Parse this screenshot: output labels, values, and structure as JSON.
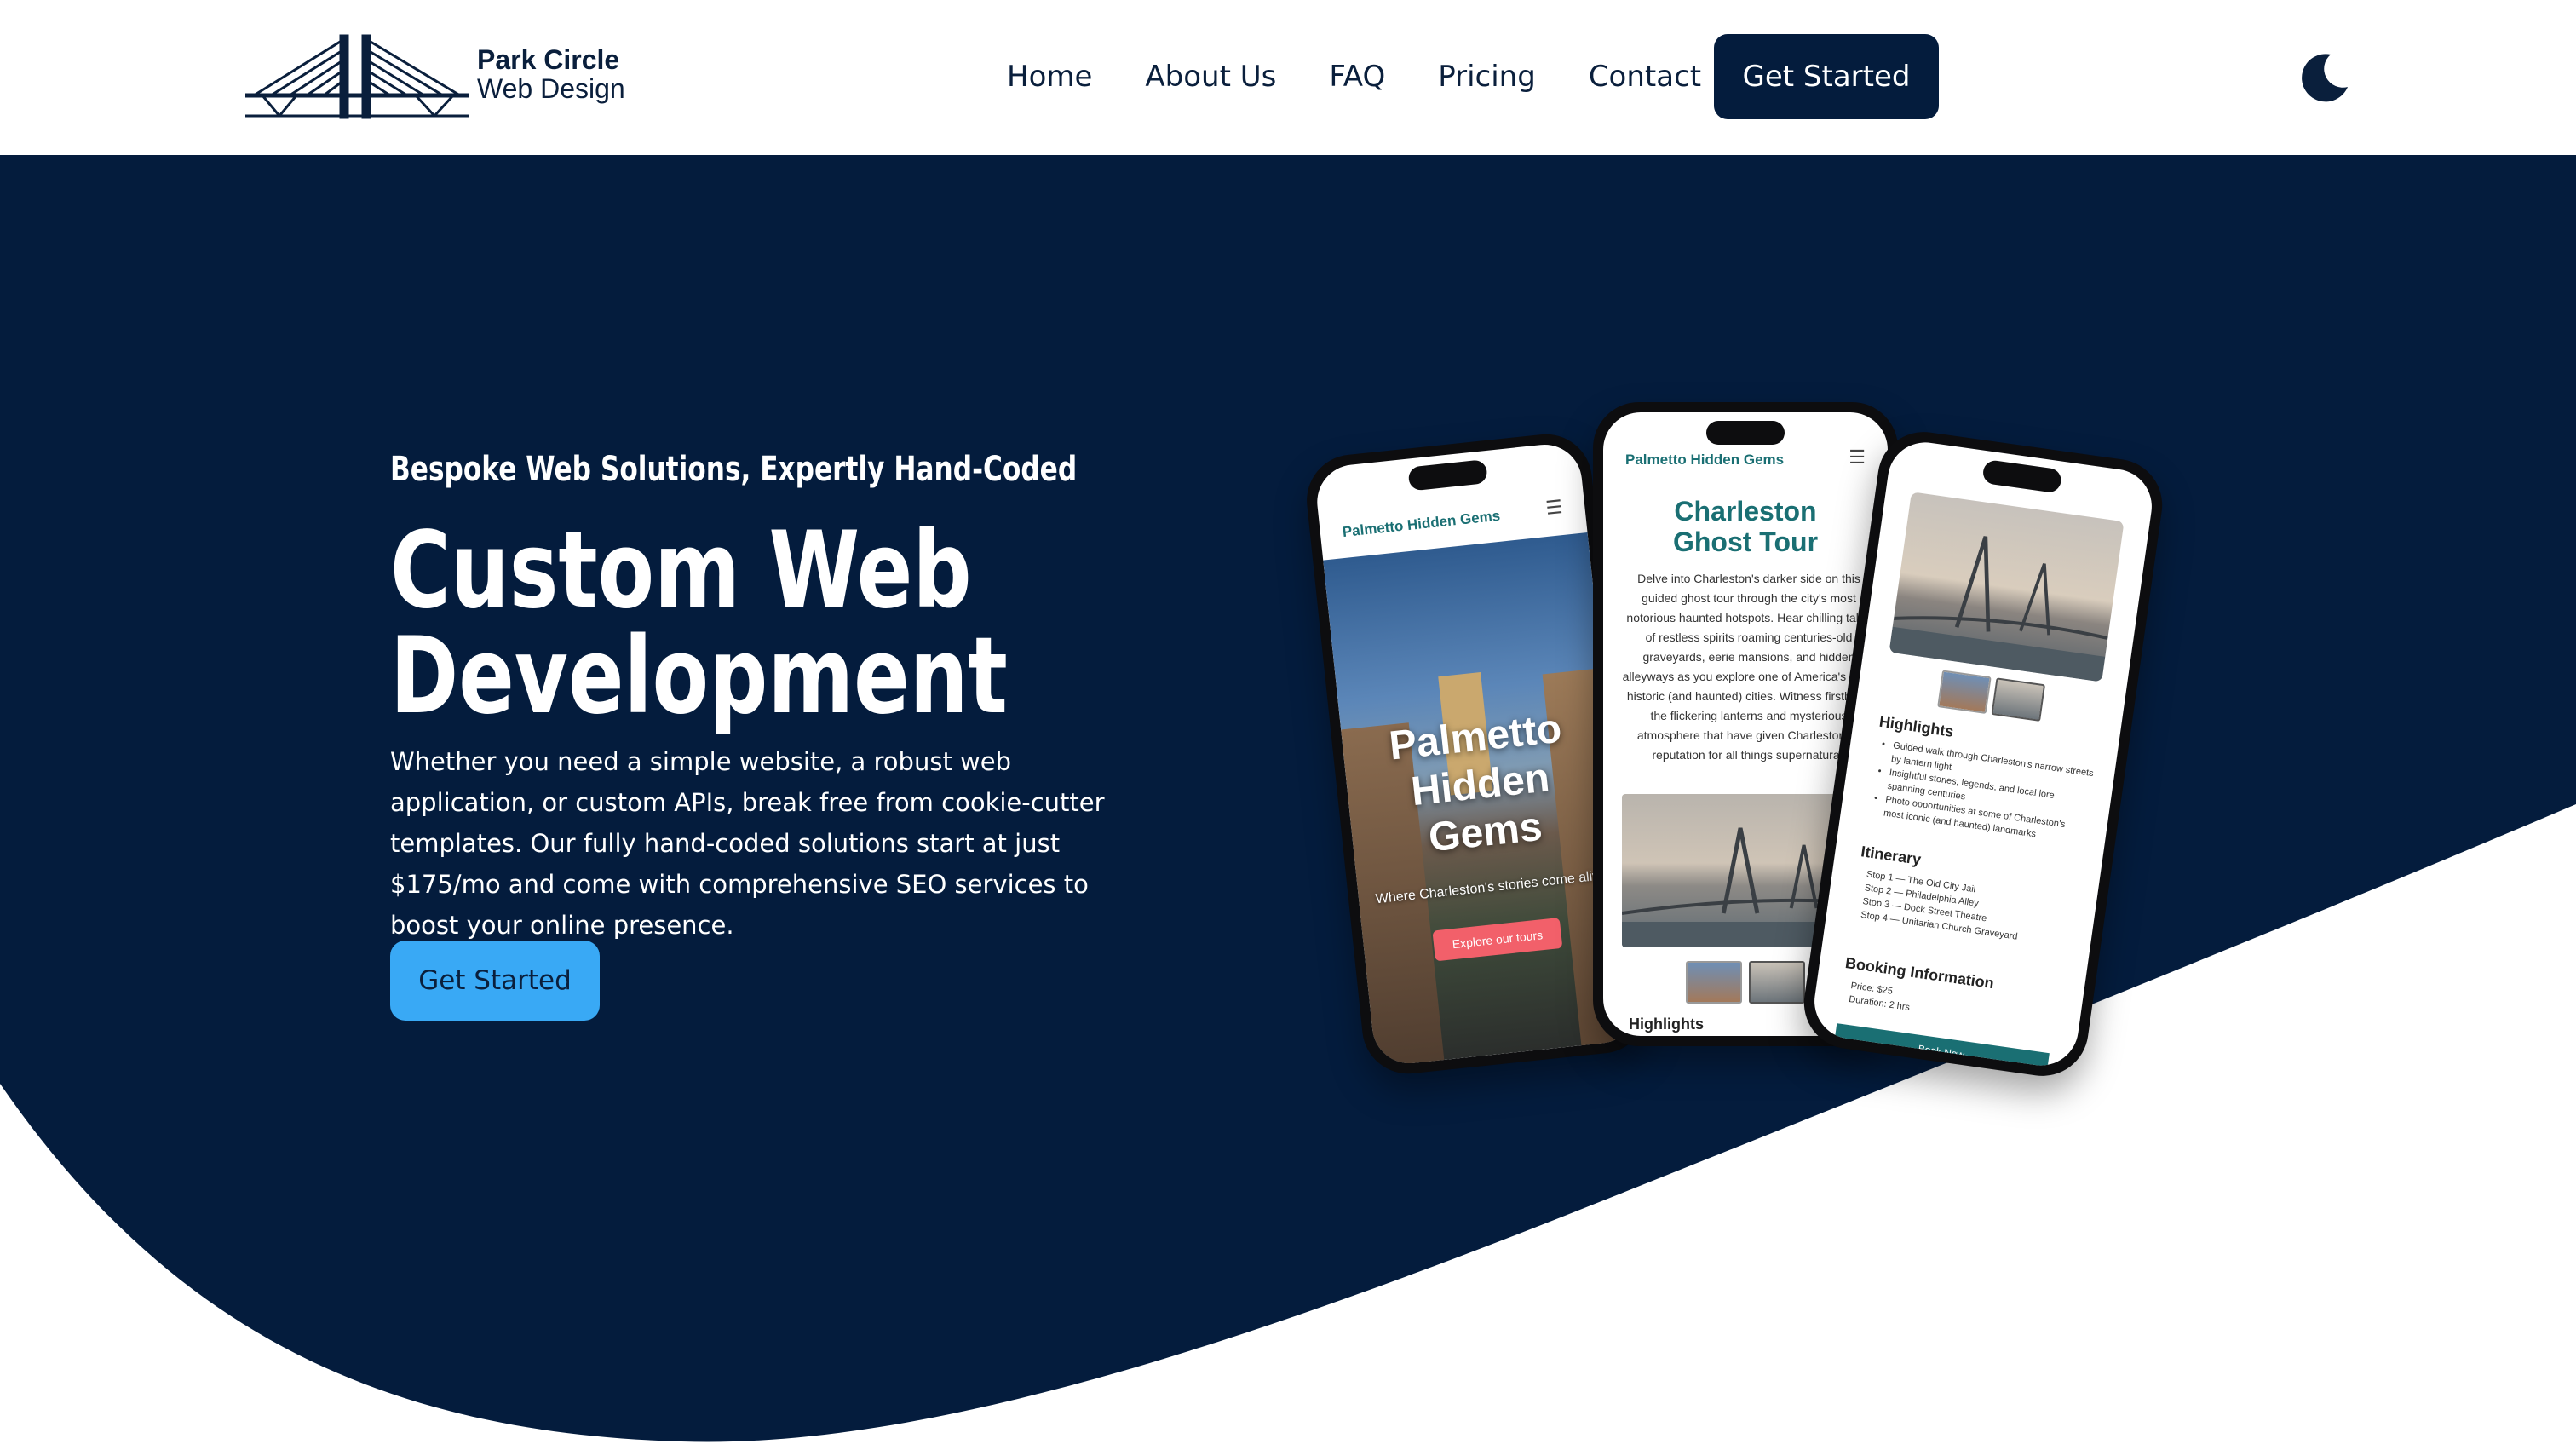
{
  "brand": {
    "line1": "Park Circle",
    "line2": "Web Design"
  },
  "nav": {
    "items": [
      "Home",
      "About Us",
      "FAQ",
      "Pricing",
      "Contact"
    ],
    "cta": "Get Started"
  },
  "theme_toggle": {
    "icon": "moon-icon"
  },
  "hero": {
    "subtitle": "Bespoke Web Solutions, Expertly Hand-Coded",
    "title_line1": "Custom Web",
    "title_line2": "Development",
    "description": "Whether you need a simple website, a robust web application, or custom APIs, break free from cookie-cutter templates. Our fully hand-coded solutions start at just $175/mo and come with comprehensive SEO services to boost your online presence.",
    "cta": "Get Started"
  },
  "phones": {
    "left": {
      "brand": "Palmetto Hidden Gems",
      "title_lines": [
        "Palmetto",
        "Hidden",
        "Gems"
      ],
      "tagline": "Where Charleston's stories come alive",
      "button": "Explore our tours"
    },
    "middle": {
      "brand": "Palmetto Hidden Gems",
      "title_lines": [
        "Charleston",
        "Ghost Tour"
      ],
      "body": "Delve into Charleston's darker side on this guided ghost tour through the city's most notorious haunted hotspots. Hear chilling tales of restless spirits roaming centuries-old graveyards, eerie mansions, and hidden alleyways as you explore one of America's most historic (and haunted) cities. Witness firsthand the flickering lanterns and mysterious atmosphere that have given Charleston its reputation for all things supernatural.",
      "section": "Highlights"
    },
    "right": {
      "highlights_heading": "Highlights",
      "highlights": [
        "Guided walk through Charleston's narrow streets by lantern light",
        "Insightful stories, legends, and local lore spanning centuries",
        "Photo opportunities at some of Charleston's most iconic (and haunted) landmarks"
      ],
      "itinerary_heading": "Itinerary",
      "itinerary": [
        "Stop 1 — The Old City Jail",
        "Stop 2 — Philadelphia Alley",
        "Stop 3 — Dock Street Theatre",
        "Stop 4 — Unitarian Church Graveyard"
      ],
      "booking_heading": "Booking Information",
      "price": "Price: $25",
      "duration": "Duration: 2 hrs",
      "button": "Book Now"
    }
  },
  "colors": {
    "navy": "#041c3d",
    "accent_blue": "#39a9f5",
    "teal": "#1a6f73",
    "coral": "#f2606a"
  }
}
